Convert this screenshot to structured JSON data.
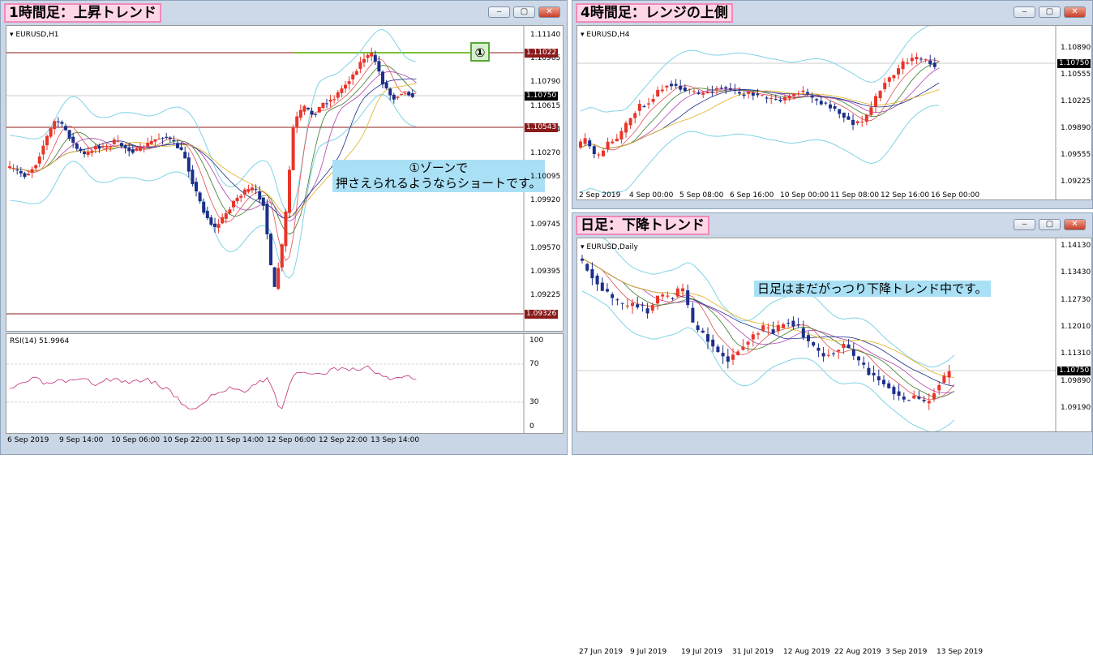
{
  "w1": {
    "title": "1時間足：上昇トレンド",
    "symbol": "EURUSD,H1",
    "prices": [
      "1.11140",
      "1.10965",
      "1.10790",
      "1.10615",
      "1.10444",
      "1.10270",
      "1.10095",
      "1.09920",
      "1.09745",
      "1.09570",
      "1.09395",
      "1.09225"
    ],
    "level_top": "1.11022",
    "level_cur": "1.10750",
    "level_mid": "1.10543",
    "level_low": "1.09326",
    "times": [
      "6 Sep 2019",
      "9 Sep 14:00",
      "10 Sep 06:00",
      "10 Sep 22:00",
      "11 Sep 14:00",
      "12 Sep 06:00",
      "12 Sep 22:00",
      "13 Sep 14:00"
    ],
    "badge": "①",
    "annot_line1": "①ゾーンで",
    "annot_line2": "押さえられるようならショートです。",
    "rsi_label": "RSI(14) 51.9964",
    "rsi_levels": [
      "100",
      "70",
      "30",
      "0"
    ]
  },
  "w2": {
    "title": "4時間足：レンジの上側",
    "symbol": "EURUSD,H4",
    "prices": [
      "1.10890",
      "1.10555",
      "1.10225",
      "1.09890",
      "1.09555",
      "1.09225"
    ],
    "level_cur": "1.10750",
    "times": [
      "2 Sep 2019",
      "4 Sep 00:00",
      "5 Sep 08:00",
      "6 Sep 16:00",
      "10 Sep 00:00",
      "11 Sep 08:00",
      "12 Sep 16:00",
      "16 Sep 00:00"
    ]
  },
  "w3": {
    "title": "日足：下降トレンド",
    "symbol": "EURUSD,Daily",
    "prices": [
      "1.14130",
      "1.13430",
      "1.12730",
      "1.12010",
      "1.11310",
      "1.09890",
      "1.09190"
    ],
    "level_cur": "1.10750",
    "times": [
      "27 Jun 2019",
      "9 Jul 2019",
      "19 Jul 2019",
      "31 Jul 2019",
      "12 Aug 2019",
      "22 Aug 2019",
      "3 Sep 2019",
      "13 Sep 2019"
    ],
    "annot": "日足はまだがっつり下降トレンド中です。"
  },
  "colors": {
    "bull": "#e8352a",
    "bear": "#1c2f8a",
    "level": "#8b1a1a",
    "band": "#7fd3e6"
  }
}
